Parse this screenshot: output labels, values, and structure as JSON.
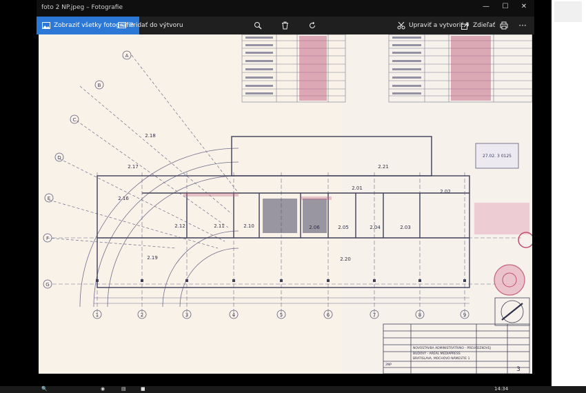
{
  "window": {
    "title": "foto 2 NP.jpeg – Fotografie",
    "controls": {
      "minimize": "—",
      "maximize": "☐",
      "close": "✕"
    }
  },
  "toolbar": {
    "show_all_photos": "Zobraziť všetky fotografie",
    "add_to_creation": "Pridať do výtvoru",
    "edit_create": "Upraviť a vytvoriť",
    "share": "Zdieľať",
    "more": "···"
  },
  "icons": {
    "zoom": "zoom-icon",
    "delete": "trash-icon",
    "rotate": "rotate-icon",
    "print": "print-icon"
  },
  "plan": {
    "axes_letters": [
      "A",
      "B",
      "C",
      "D",
      "E",
      "F",
      "G"
    ],
    "axes_numbers": [
      "1",
      "2",
      "3",
      "4",
      "5",
      "6",
      "7",
      "8",
      "9"
    ],
    "rooms": [
      "2.18",
      "2.17",
      "2.16",
      "2.12",
      "2.11",
      "2.10",
      "2.06",
      "2.05",
      "2.04",
      "2.03",
      "2.02",
      "2.01",
      "2.21",
      "2.19",
      "2.20"
    ],
    "title_block_lines": [
      "NOVOSTAVBA ADMINISTRATÍVNO - PREVÁDZKOVEJ",
      "BUDOVY - AREÁL MEDIAPRESS",
      "BRATISLAVA, MOCHOVO NÁMESTIE 1"
    ],
    "sheet_type": "2NP",
    "sheet_number": "3",
    "stamp_date": "27.02.   3   0125"
  },
  "taskbar": {
    "time": "14:34"
  }
}
